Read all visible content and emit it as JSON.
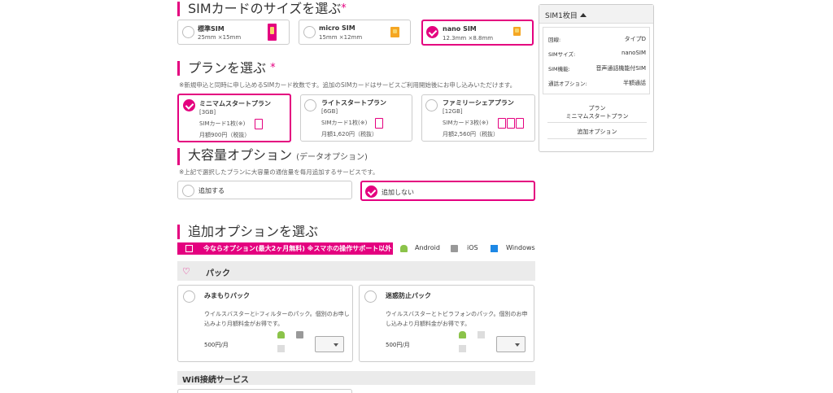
{
  "sim_size": {
    "title": "SIMカードのサイズを選ぶ",
    "required": "*",
    "options": [
      {
        "label": "標準SIM",
        "dims": "25mm ×15mm"
      },
      {
        "label": "micro SIM",
        "dims": "15mm ×12mm"
      },
      {
        "label": "nano SIM",
        "dims": "12.3mm ×8.8mm"
      }
    ]
  },
  "plan": {
    "title": "プランを選ぶ",
    "required": "*",
    "note": "※新規申込と同時に申し込めるSIMカード枚数です。追加のSIMカードはサービスご利用開始後にお申し込みいただけます。",
    "options": [
      {
        "name": "ミニマムスタートプラン",
        "size": "[3GB]",
        "sim": "SIMカード1枚(※)",
        "price": "月額900円（税抜）"
      },
      {
        "name": "ライトスタートプラン",
        "size": "[6GB]",
        "sim": "SIMカード1枚(※)",
        "price": "月額1,620円（税抜）"
      },
      {
        "name": "ファミリーシェアプラン",
        "size": "[12GB]",
        "sim": "SIMカード3枚(※)",
        "price": "月額2,560円（税抜）"
      }
    ]
  },
  "capacity": {
    "title": "大容量オプション",
    "subtitle": "(データオプション)",
    "note": "※上記で選択したプランに大容量の通信量を毎月追加するサービスです。",
    "options": [
      {
        "label": "追加する"
      },
      {
        "label": "追加しない"
      }
    ]
  },
  "addon": {
    "title": "追加オプションを選ぶ",
    "banner": "今ならオプション(最大2ヶ月無料) ※スマホの操作サポート以外",
    "os": [
      "Android",
      "iOS",
      "Windows"
    ],
    "pack_heading": "パック",
    "cards": [
      {
        "title": "みまもりパック",
        "desc": "ウイルスバスターとi-フィルターのパック。個別のお申し込みより月額料金がお得です。",
        "price": "500円/月"
      },
      {
        "title": "迷惑防止パック",
        "desc": "ウイルスバスターとトビラフォンのパック。個別のお申し込みより月額料金がお得です。",
        "price": "500円/月"
      }
    ],
    "wifi_heading": "Wifi接続サービス"
  },
  "sidebar": {
    "header": "SIM1枚目",
    "rows": [
      {
        "key": "回線:",
        "value": "タイプD"
      },
      {
        "key": "SIMサイズ:",
        "value": "nanoSIM"
      },
      {
        "key": "SIM機能:",
        "value": "音声通話機能付SIM"
      },
      {
        "key": "通話オプション:",
        "value": "半額通話"
      }
    ],
    "plan_label": "プラン",
    "plan_value": "ミニマムスタートプラン",
    "addon_label": "追加オプション"
  },
  "colors": {
    "accent": "#e4007f",
    "band": "#ebebeb"
  }
}
